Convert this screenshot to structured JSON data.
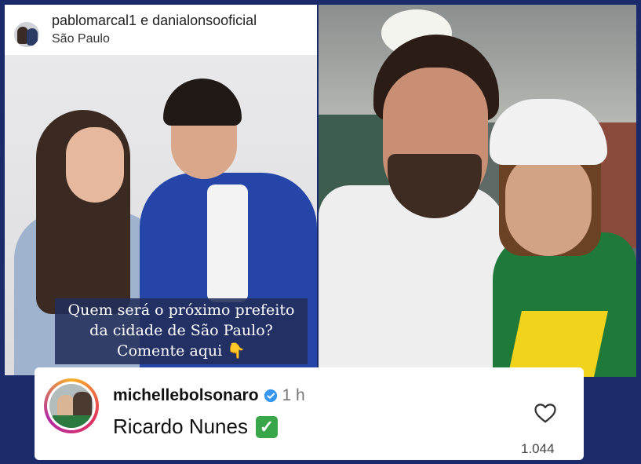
{
  "story": {
    "header_title": "pablomarcal1 e danialonsooficial",
    "location": "São Paulo",
    "caption_lines": [
      "Quem será o próximo prefeito",
      "da cidade de São Paulo?",
      "Comente aqui 👇"
    ]
  },
  "comment": {
    "username": "michellebolsonaro",
    "time": "1 h",
    "text": "Ricardo Nunes",
    "likes": "1.044"
  },
  "icons": {
    "verified": "verified-badge-icon",
    "check": "green-check-emoji-icon",
    "heart": "heart-icon",
    "avatar": "avatar"
  },
  "colors": {
    "frame": "#1b2a6b",
    "verified": "#3897f0",
    "check": "#3aa64a",
    "caption_bg": "#222d5a"
  }
}
